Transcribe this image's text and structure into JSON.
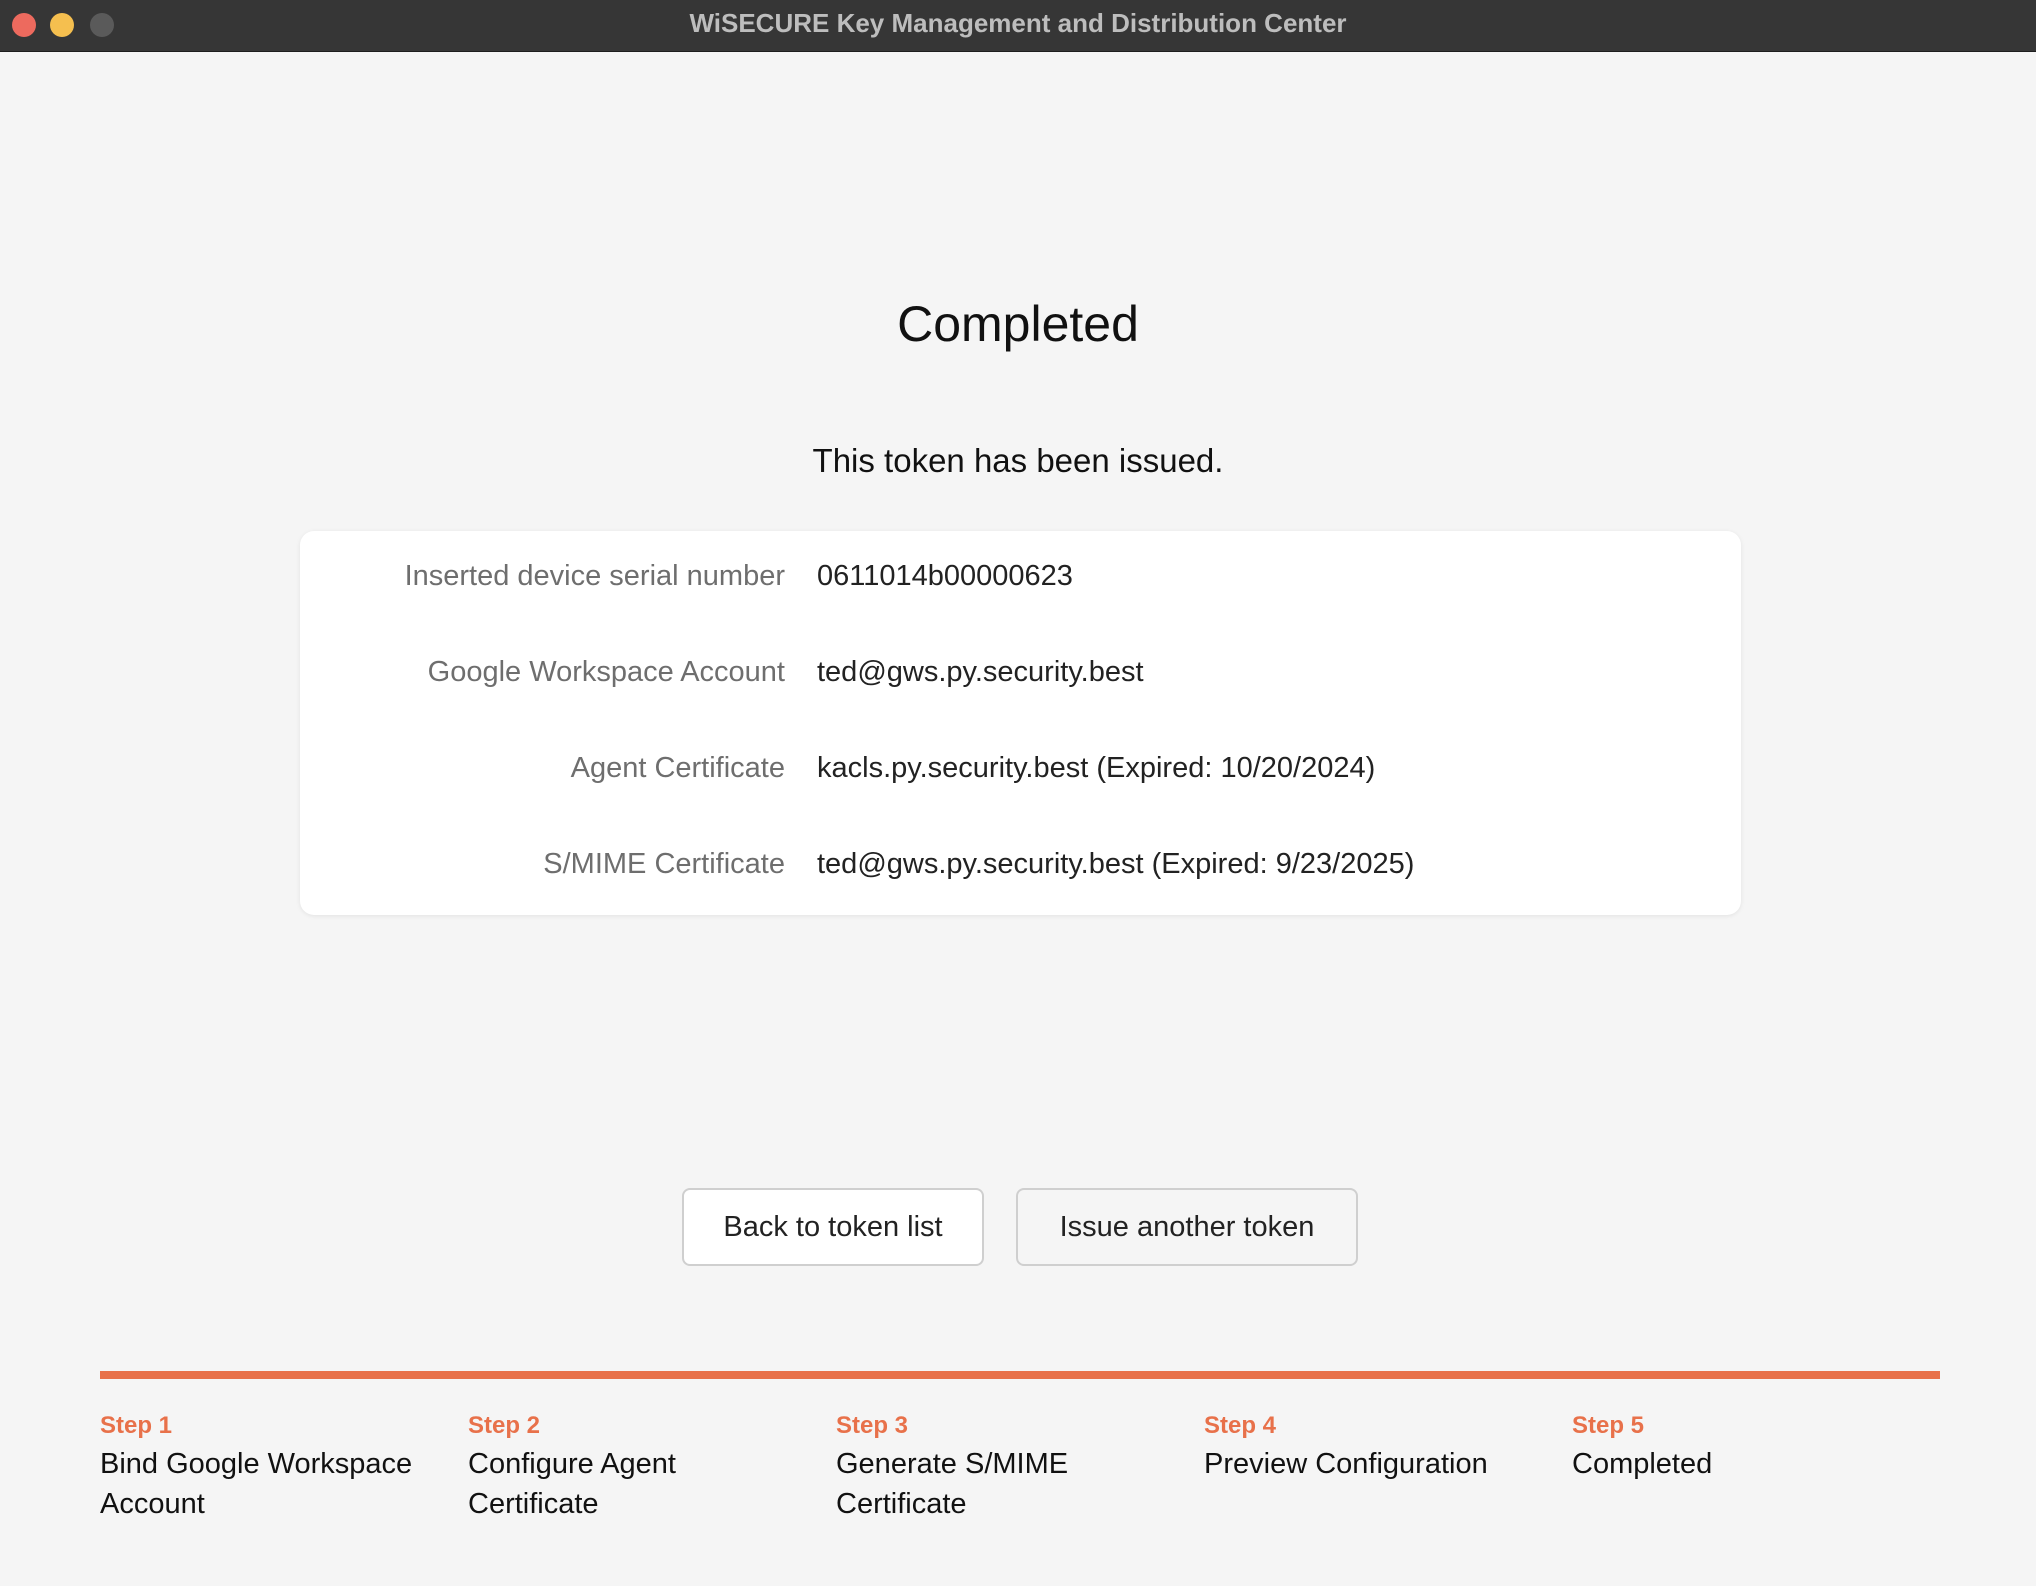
{
  "window": {
    "title": "WiSECURE Key Management and Distribution Center"
  },
  "main": {
    "title": "Completed",
    "subtitle": "This token has been issued.",
    "details": [
      {
        "label": "Inserted device serial number",
        "value": "0611014b00000623"
      },
      {
        "label": "Google Workspace Account",
        "value": "ted@gws.py.security.best"
      },
      {
        "label": "Agent Certificate",
        "value": "kacls.py.security.best (Expired: 10/20/2024)"
      },
      {
        "label": "S/MIME Certificate",
        "value": "ted@gws.py.security.best (Expired: 9/23/2025)"
      }
    ]
  },
  "actions": {
    "back_label": "Back to token list",
    "issue_label": "Issue another token"
  },
  "steps": [
    {
      "number": "Step 1",
      "name": "Bind Google Workspace Account"
    },
    {
      "number": "Step 2",
      "name": "Configure Agent Certificate"
    },
    {
      "number": "Step 3",
      "name": "Generate S/MIME Certificate"
    },
    {
      "number": "Step 4",
      "name": "Preview Configuration"
    },
    {
      "number": "Step 5",
      "name": "Completed"
    }
  ],
  "progress": {
    "completed_steps": 5,
    "total_steps": 5
  },
  "colors": {
    "accent": "#e8714a",
    "titlebar": "#363636",
    "background": "#f5f5f5",
    "card": "#ffffff"
  },
  "icons": {
    "close": "close-window-icon",
    "minimize": "minimize-window-icon",
    "maximize": "maximize-window-icon"
  }
}
